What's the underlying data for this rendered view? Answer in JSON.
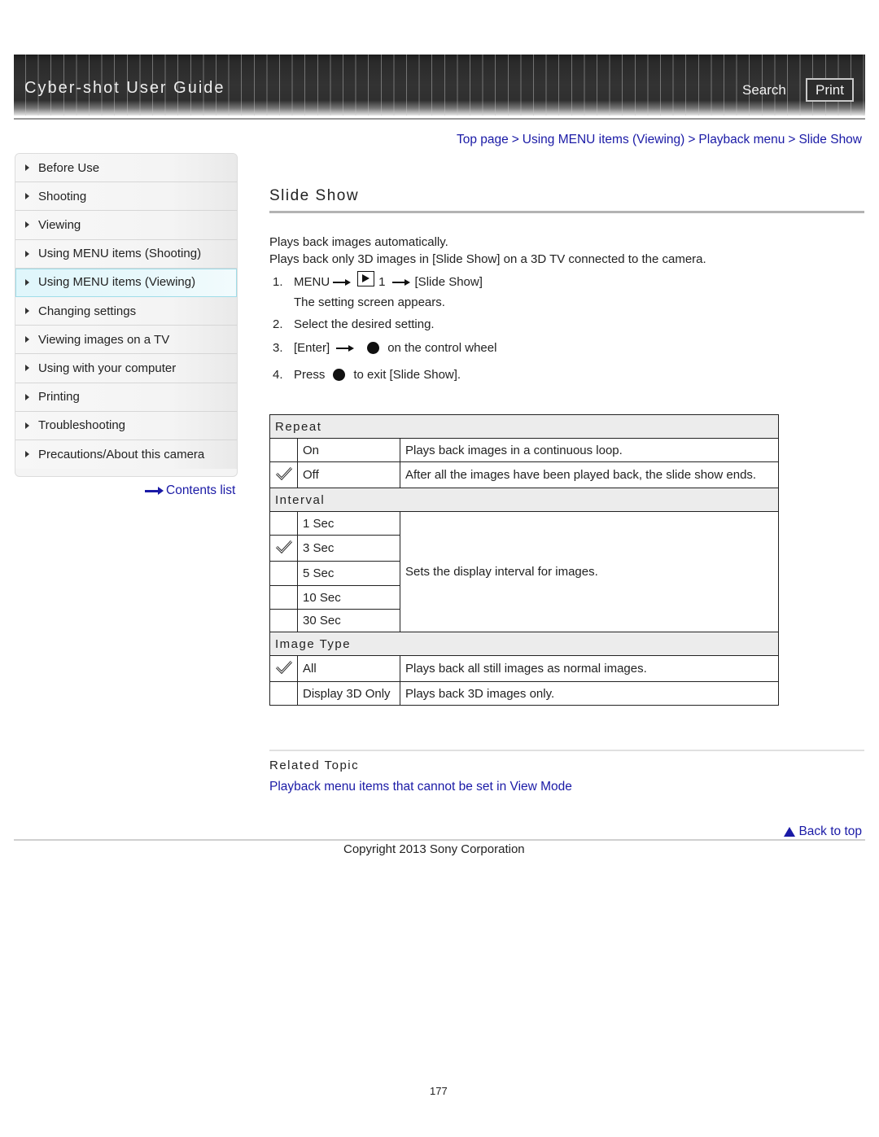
{
  "header": {
    "title": "Cyber-shot User Guide",
    "search_label": "Search",
    "print_label": "Print"
  },
  "breadcrumb": [
    {
      "label": "Top page"
    },
    {
      "label": "Using MENU items (Viewing)"
    },
    {
      "label": "Playback menu"
    },
    {
      "label": "Slide Show"
    }
  ],
  "breadcrumb_separator": ">",
  "sidebar": {
    "items": [
      {
        "label": "Before Use",
        "active": false
      },
      {
        "label": "Shooting",
        "active": false
      },
      {
        "label": "Viewing",
        "active": false
      },
      {
        "label": "Using MENU items (Shooting)",
        "active": false
      },
      {
        "label": "Using MENU items (Viewing)",
        "active": true
      },
      {
        "label": "Changing settings",
        "active": false
      },
      {
        "label": "Viewing images on a TV",
        "active": false
      },
      {
        "label": "Using with your computer",
        "active": false
      },
      {
        "label": "Printing",
        "active": false
      },
      {
        "label": "Troubleshooting",
        "active": false
      },
      {
        "label": "Precautions/About this camera",
        "active": false
      }
    ],
    "contents_link": "Contents list"
  },
  "main": {
    "title": "Slide Show",
    "intro": [
      "Plays back images automatically.",
      "Plays back only 3D images in [Slide Show] on a 3D TV connected to the camera."
    ],
    "steps": [
      {
        "num": "1.",
        "menu": "MENU",
        "tab_number": "1",
        "target": "[Slide Show]",
        "note": "The setting screen appears."
      },
      {
        "num": "2.",
        "text": "Select the desired setting."
      },
      {
        "num": "3.",
        "pre": "[Enter]",
        "post": "on the control wheel"
      },
      {
        "num": "4.",
        "pre": "Press",
        "post": "to exit [Slide Show]."
      }
    ],
    "settings": {
      "repeat": {
        "label": "Repeat",
        "options": [
          {
            "name": "On",
            "selected": false,
            "desc": "Plays back images in a continuous loop."
          },
          {
            "name": "Off",
            "selected": true,
            "desc": "After all the images have been played back, the slide show ends."
          }
        ]
      },
      "interval": {
        "label": "Interval",
        "desc": "Sets the display interval for images.",
        "options": [
          {
            "name": "1 Sec",
            "selected": false
          },
          {
            "name": "3 Sec",
            "selected": true
          },
          {
            "name": "5 Sec",
            "selected": false
          },
          {
            "name": "10 Sec",
            "selected": false
          },
          {
            "name": "30 Sec",
            "selected": false
          }
        ]
      },
      "image_type": {
        "label": "Image Type",
        "options": [
          {
            "name": "All",
            "selected": true,
            "desc": "Plays back all still images as normal images."
          },
          {
            "name": "Display 3D Only",
            "selected": false,
            "desc": "Plays back 3D images only."
          }
        ]
      }
    },
    "related": {
      "title": "Related Topic",
      "links": [
        "Playback menu items that cannot be set in View Mode"
      ]
    }
  },
  "footer": {
    "back_to_top": "Back to top",
    "copyright": "Copyright 2013 Sony Corporation",
    "page_number": "177"
  },
  "colors": {
    "link": "#1a1aa6",
    "active_nav": "#dff6fb",
    "table_header": "#ececec"
  }
}
